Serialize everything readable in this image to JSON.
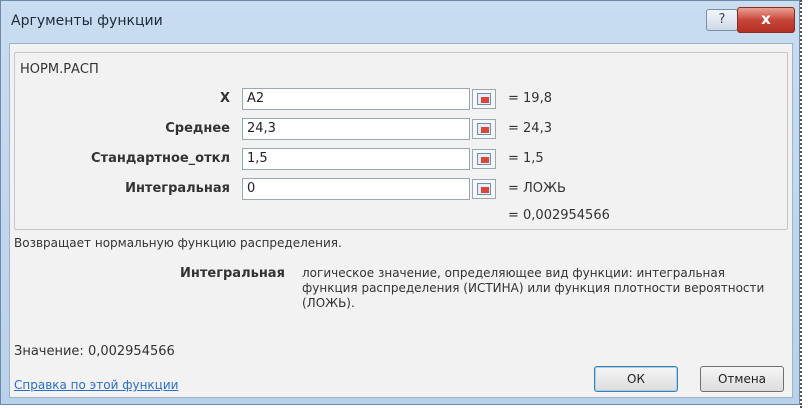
{
  "dialog": {
    "title": "Аргументы функции",
    "help_button": "?",
    "close_button": "x"
  },
  "function": {
    "name": "НОРМ.РАСП"
  },
  "arguments": [
    {
      "label": "X",
      "input": "A2",
      "value": "= 19,8"
    },
    {
      "label": "Среднее",
      "input": "24,3",
      "value": "= 24,3"
    },
    {
      "label": "Стандартное_откл",
      "input": "1,5",
      "value": "= 1,5"
    },
    {
      "label": "Интегральная",
      "input": "0",
      "value": "= ЛОЖЬ"
    }
  ],
  "result": "= 0,002954566",
  "description": "Возвращает нормальную функцию распределения.",
  "param_help": {
    "name": "Интегральная",
    "text": "логическое значение, определяющее вид функции: интегральная функция распределения (ИСТИНА) или функция плотности вероятности (ЛОЖЬ)."
  },
  "value_line": "Значение:  0,002954566",
  "help_link": "Справка по этой функции",
  "buttons": {
    "ok": "ОК",
    "cancel": "Отмена"
  },
  "icons": {
    "collapse": "collapse-dialog-icon"
  }
}
